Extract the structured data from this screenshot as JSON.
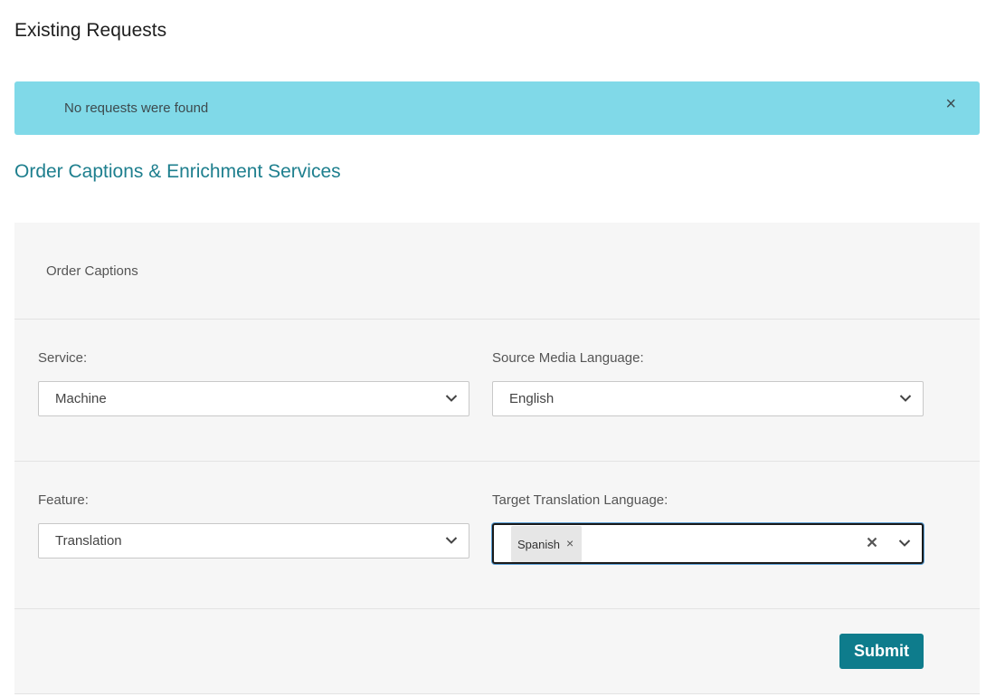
{
  "existing_requests": {
    "heading": "Existing Requests",
    "alert": {
      "message": "No requests were found",
      "close_glyph": "×",
      "color": "#80d9e8"
    }
  },
  "order": {
    "heading": "Order Captions & Enrichment Services",
    "heading_color": "#1e7f8e",
    "panel_title": "Order Captions",
    "fields": {
      "service": {
        "label": "Service:",
        "value": "Machine"
      },
      "source_language": {
        "label": "Source Media Language:",
        "value": "English"
      },
      "feature": {
        "label": "Feature:",
        "value": "Translation"
      },
      "target_language": {
        "label": "Target Translation Language:",
        "selected": [
          {
            "label": "Spanish",
            "remove_glyph": "×"
          }
        ]
      }
    },
    "submit_label": "Submit",
    "accent_color": "#0e7c8c"
  }
}
